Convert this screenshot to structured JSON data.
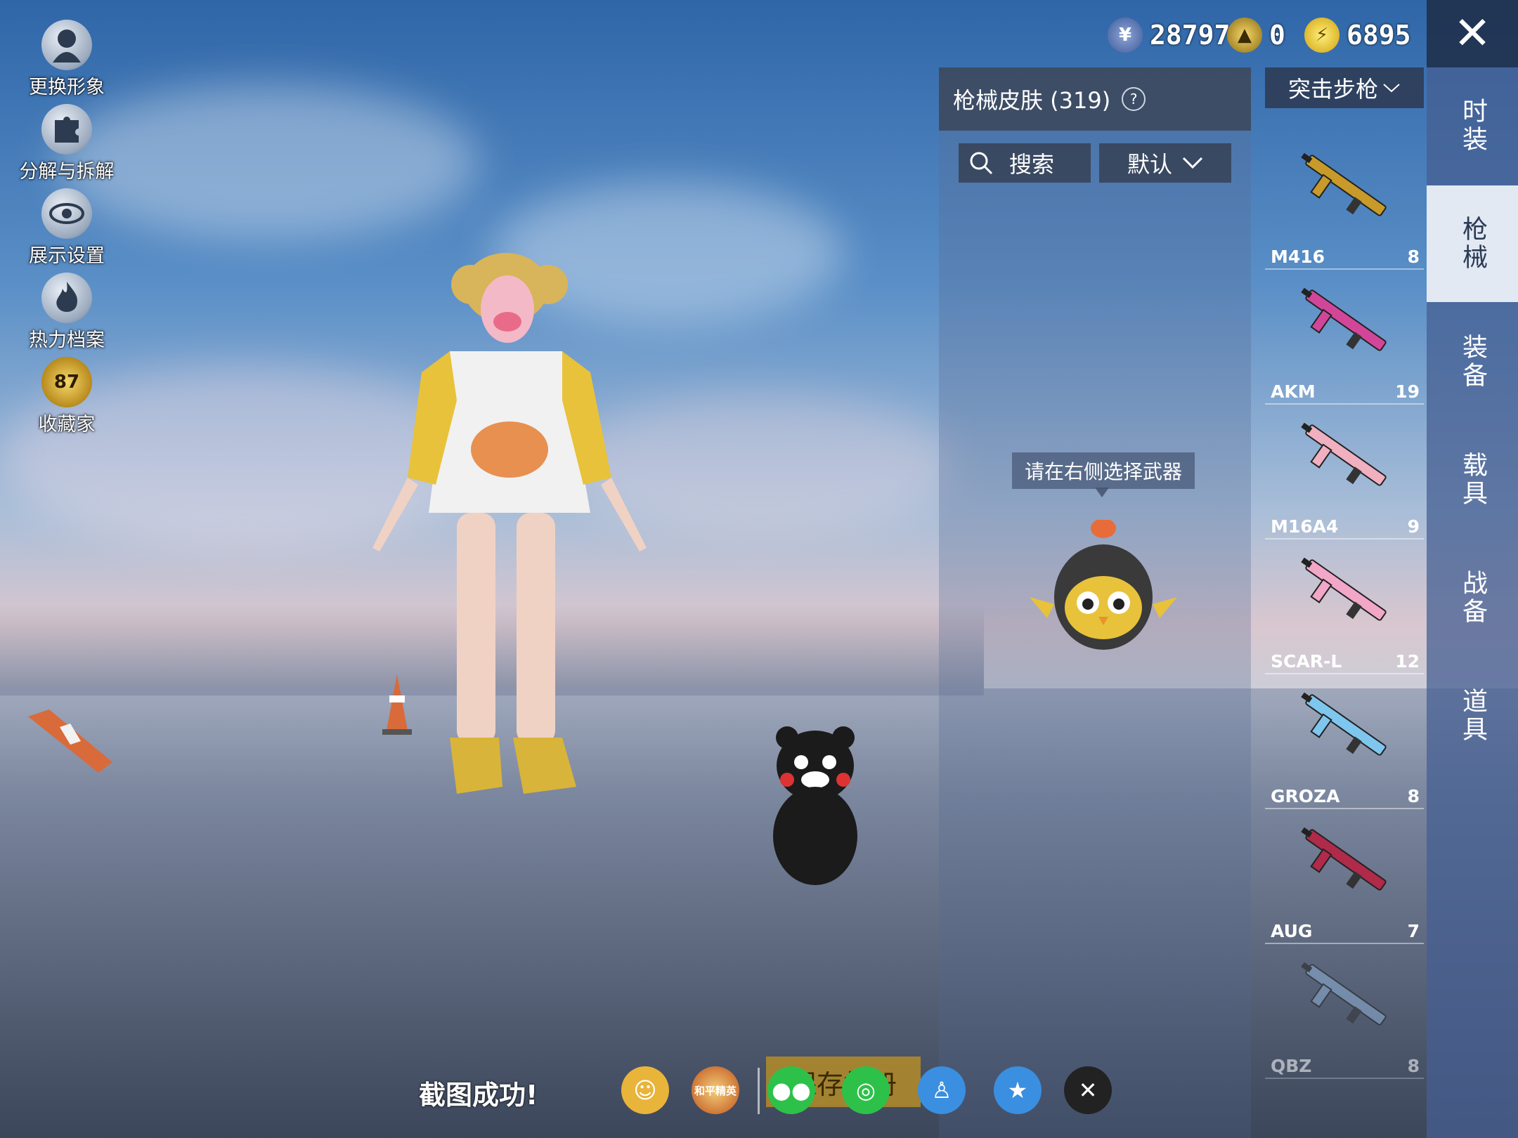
{
  "left_menu": {
    "items": [
      {
        "label": "更换形象",
        "icon": "avatar-icon"
      },
      {
        "label": "分解与拆解",
        "icon": "puzzle-icon"
      },
      {
        "label": "展示设置",
        "icon": "eye-icon"
      },
      {
        "label": "热力档案",
        "icon": "flame-icon"
      },
      {
        "label": "收藏家",
        "icon": "collector-badge-icon",
        "badge": "87"
      }
    ]
  },
  "currencies": [
    {
      "icon": "token-icon",
      "value": "28797",
      "color": "#3e5a9a"
    },
    {
      "icon": "gold-coin-icon",
      "value": "0",
      "color": "#c9a12a"
    },
    {
      "icon": "lightning-coin-icon",
      "value": "6895",
      "color": "#e0b820"
    }
  ],
  "skin_panel": {
    "title": "枪械皮肤 (319)",
    "search_label": "搜索",
    "sort_label": "默认",
    "hint": "请在右侧选择武器"
  },
  "weapon_list": {
    "category": "突击步枪",
    "items": [
      {
        "name": "M416",
        "count": "8",
        "color": "#c79a2a"
      },
      {
        "name": "AKM",
        "count": "19",
        "color": "#d2469a"
      },
      {
        "name": "M16A4",
        "count": "9",
        "color": "#f0b0c0"
      },
      {
        "name": "SCAR-L",
        "count": "12",
        "color": "#f2a6c8"
      },
      {
        "name": "GROZA",
        "count": "8",
        "color": "#7ec6ee"
      },
      {
        "name": "AUG",
        "count": "7",
        "color": "#b02a4a"
      },
      {
        "name": "QBZ",
        "count": "8",
        "color": "#8fb2d6"
      }
    ]
  },
  "tabs": [
    {
      "label": "时装",
      "active": false
    },
    {
      "label": "枪械",
      "active": true
    },
    {
      "label": "装备",
      "active": false
    },
    {
      "label": "载具",
      "active": false
    },
    {
      "label": "战备",
      "active": false
    },
    {
      "label": "道具",
      "active": false
    }
  ],
  "share_bar": {
    "success_text": "截图成功!",
    "save_label": "保存相册",
    "game_logo_text": "和平精英",
    "buttons": [
      "profile-share-icon",
      "game-logo-icon",
      "wechat-icon",
      "moments-icon",
      "qq-icon",
      "qzone-icon",
      "x-share-icon"
    ]
  }
}
